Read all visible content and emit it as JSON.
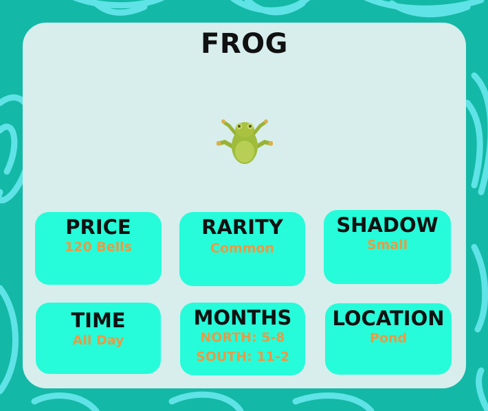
{
  "creature": {
    "name": "FROG",
    "image_icon": "frog-icon"
  },
  "tiles": {
    "price": {
      "label": "PRICE",
      "value": "120 Bells"
    },
    "rarity": {
      "label": "RARITY",
      "value": "Common"
    },
    "shadow": {
      "label": "SHADOW",
      "value": "Small"
    },
    "time": {
      "label": "TIME",
      "value": "All Day"
    },
    "months": {
      "label": "MONTHS",
      "north": "NORTH: 5-8",
      "south": "SOUTH: 11-2"
    },
    "location": {
      "label": "LOCATION",
      "value": "Pond"
    }
  },
  "colors": {
    "background": "#14b8a6",
    "pattern": "#5fe3e6",
    "card": "#d7eeed",
    "tile": "#26fcd9",
    "value_text": "#e99a45"
  }
}
